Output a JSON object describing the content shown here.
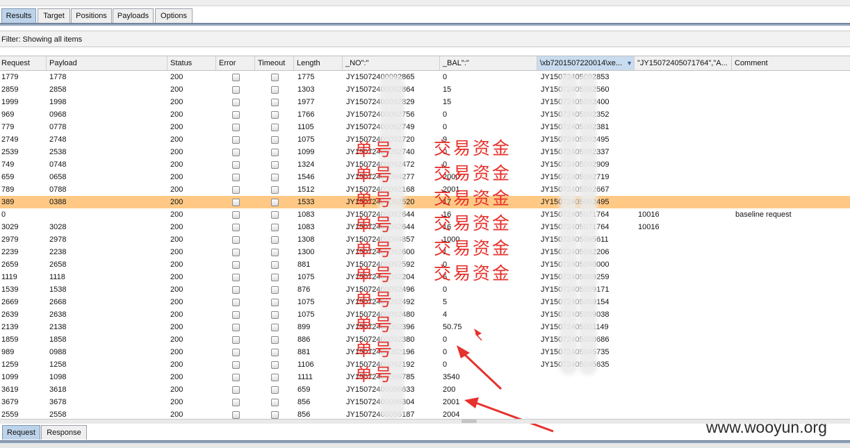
{
  "tabs": [
    "Results",
    "Target",
    "Positions",
    "Payloads",
    "Options"
  ],
  "filter": "Filter:  Showing all items",
  "columns": [
    "Request",
    "Payload",
    "Status",
    "Error",
    "Timeout",
    "Length",
    "_NO\":\"",
    "_BAL\":\"",
    "\\xb7201507220014\\xe...",
    "\"JY15072405071764\",\"A...",
    "Comment"
  ],
  "sorted_column_indicator": "▼",
  "rows": [
    {
      "request": "1779",
      "payload": "1778",
      "status": "200",
      "length": "1775",
      "no": "JY15072400092865",
      "bal": "0",
      "xb": "JY15072405092853",
      "jy": "",
      "comment": ""
    },
    {
      "request": "2859",
      "payload": "2858",
      "status": "200",
      "length": "1303",
      "no": "JY15072400092864",
      "bal": "15",
      "xb": "JY15072405092560",
      "jy": "",
      "comment": ""
    },
    {
      "request": "1999",
      "payload": "1998",
      "status": "200",
      "length": "1977",
      "no": "JY15072400092829",
      "bal": "15",
      "xb": "JY15072405092400",
      "jy": "",
      "comment": ""
    },
    {
      "request": "969",
      "payload": "0968",
      "status": "200",
      "length": "1766",
      "no": "JY15072400092756",
      "bal": "0",
      "xb": "JY15072405092352",
      "jy": "",
      "comment": ""
    },
    {
      "request": "779",
      "payload": "0778",
      "status": "200",
      "length": "1105",
      "no": "JY15072400092749",
      "bal": "0",
      "xb": "JY15072405092381",
      "jy": "",
      "comment": ""
    },
    {
      "request": "2749",
      "payload": "2748",
      "status": "200",
      "length": "1075",
      "no": "JY15072400092720",
      "bal": "9",
      "xb": "JY15072405092495",
      "jy": "",
      "comment": ""
    },
    {
      "request": "2539",
      "payload": "2538",
      "status": "200",
      "length": "1099",
      "no": "JY15072400092740",
      "bal": "0",
      "xb": "JY15072405092337",
      "jy": "",
      "comment": ""
    },
    {
      "request": "749",
      "payload": "0748",
      "status": "200",
      "length": "1324",
      "no": "JY15072400092472",
      "bal": "0",
      "xb": "JY15072405092909",
      "jy": "",
      "comment": ""
    },
    {
      "request": "659",
      "payload": "0658",
      "status": "200",
      "length": "1546",
      "no": "JY15072400094277",
      "bal": "2000",
      "xb": "JY15072405092719",
      "jy": "",
      "comment": ""
    },
    {
      "request": "789",
      "payload": "0788",
      "status": "200",
      "length": "1512",
      "no": "JY15072400092168",
      "bal": "2001",
      "xb": "JY15072405092667",
      "jy": "",
      "comment": ""
    },
    {
      "request": "389",
      "payload": "0388",
      "status": "200",
      "length": "1533",
      "no": "JY15072400092520",
      "bal": "17",
      "xb": "JY15072405092495",
      "jy": "",
      "comment": "",
      "selected": true
    },
    {
      "request": "0",
      "payload": "",
      "status": "200",
      "length": "1083",
      "no": "JY15072400092644",
      "bal": "16",
      "xb": "JY15072405071764",
      "jy": "10016",
      "comment": "baseline request"
    },
    {
      "request": "3029",
      "payload": "3028",
      "status": "200",
      "length": "1083",
      "no": "JY15072400092644",
      "bal": "16",
      "xb": "JY15072405071764",
      "jy": "10016",
      "comment": ""
    },
    {
      "request": "2979",
      "payload": "2978",
      "status": "200",
      "length": "1308",
      "no": "JY15072400094857",
      "bal": "1000",
      "xb": "JY15072405095611",
      "jy": "",
      "comment": ""
    },
    {
      "request": "2239",
      "payload": "2238",
      "status": "200",
      "length": "1300",
      "no": "JY15072400092600",
      "bal": "1",
      "xb": "JY15072405092206",
      "jy": "",
      "comment": ""
    },
    {
      "request": "2659",
      "payload": "2658",
      "status": "200",
      "length": "881",
      "no": "JY15072400092592",
      "bal": "0",
      "xb": "JY15072405090000",
      "jy": "",
      "comment": ""
    },
    {
      "request": "1119",
      "payload": "1118",
      "status": "200",
      "length": "1075",
      "no": "JY15072400092204",
      "bal": "5",
      "xb": "JY15072405059259",
      "jy": "",
      "comment": ""
    },
    {
      "request": "1539",
      "payload": "1538",
      "status": "200",
      "length": "876",
      "no": "JY15072400092496",
      "bal": "0",
      "xb": "JY15072405059171",
      "jy": "",
      "comment": ""
    },
    {
      "request": "2669",
      "payload": "2668",
      "status": "200",
      "length": "1075",
      "no": "JY15072400092492",
      "bal": "5",
      "xb": "JY15072405059154",
      "jy": "",
      "comment": ""
    },
    {
      "request": "2639",
      "payload": "2638",
      "status": "200",
      "length": "1075",
      "no": "JY15072400092480",
      "bal": "4",
      "xb": "JY15072405059038",
      "jy": "",
      "comment": ""
    },
    {
      "request": "2139",
      "payload": "2138",
      "status": "200",
      "length": "899",
      "no": "JY15072400092396",
      "bal": "50.75",
      "xb": "JY15072405051149",
      "jy": "",
      "comment": ""
    },
    {
      "request": "1859",
      "payload": "1858",
      "status": "200",
      "length": "886",
      "no": "JY15072400092380",
      "bal": "0",
      "xb": "JY15072405050686",
      "jy": "",
      "comment": ""
    },
    {
      "request": "989",
      "payload": "0988",
      "status": "200",
      "length": "881",
      "no": "JY15072400092196",
      "bal": "0",
      "xb": "JY15072405045735",
      "jy": "",
      "comment": ""
    },
    {
      "request": "1259",
      "payload": "1258",
      "status": "200",
      "length": "1106",
      "no": "JY15072400092192",
      "bal": "0",
      "xb": "JY15072405045635",
      "jy": "",
      "comment": ""
    },
    {
      "request": "1099",
      "payload": "1098",
      "status": "200",
      "length": "1111",
      "no": "JY15072400096785",
      "bal": "3540",
      "xb": "",
      "jy": "",
      "comment": ""
    },
    {
      "request": "3619",
      "payload": "3618",
      "status": "200",
      "length": "659",
      "no": "JY15072400096633",
      "bal": "200",
      "xb": "",
      "jy": "",
      "comment": ""
    },
    {
      "request": "3679",
      "payload": "3678",
      "status": "200",
      "length": "856",
      "no": "JY15072400096304",
      "bal": "2001",
      "xb": "",
      "jy": "",
      "comment": ""
    },
    {
      "request": "2559",
      "payload": "2558",
      "status": "200",
      "length": "856",
      "no": "JY15072400096187",
      "bal": "2004",
      "xb": "",
      "jy": "",
      "comment": ""
    }
  ],
  "annotations": {
    "order_no_label": "单号",
    "transaction_amount_label": "交易资金",
    "annotation_color": "#e6322c"
  },
  "bottom_tabs": [
    "Request",
    "Response"
  ],
  "watermark": "www.wooyun.org"
}
